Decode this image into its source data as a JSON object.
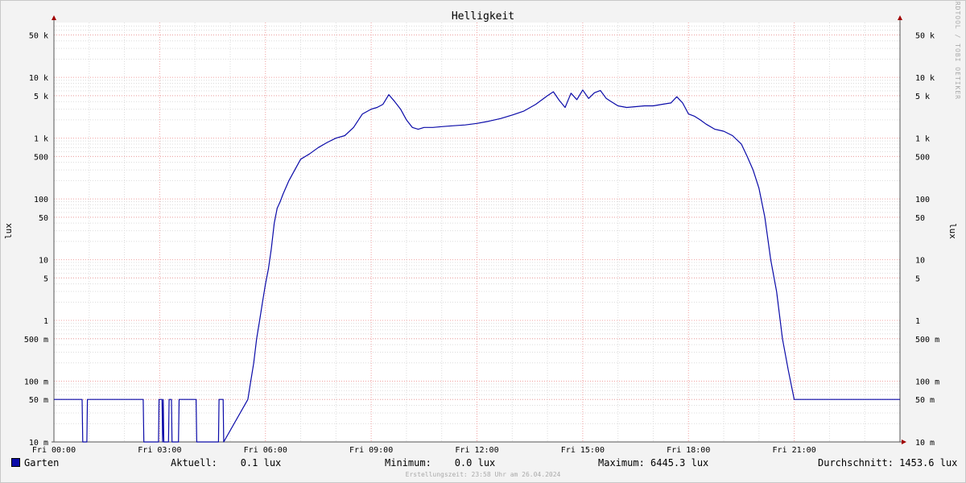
{
  "chart_data": {
    "type": "line",
    "title": "Helligkeit",
    "ylabel": "lux",
    "ylabel_right": "lux",
    "yscale": "log",
    "ylim": [
      0.01,
      80000
    ],
    "xlim": [
      "00:00",
      "24:00"
    ],
    "grid": true,
    "x_tick_labels": [
      "Fri 00:00",
      "Fri 03:00",
      "Fri 06:00",
      "Fri 09:00",
      "Fri 12:00",
      "Fri 15:00",
      "Fri 18:00",
      "Fri 21:00"
    ],
    "x_tick_hours": [
      0,
      3,
      6,
      9,
      12,
      15,
      18,
      21
    ],
    "y_ticks": [
      {
        "value": 0.01,
        "label": "10 m"
      },
      {
        "value": 0.05,
        "label": "50 m"
      },
      {
        "value": 0.1,
        "label": "100 m"
      },
      {
        "value": 0.5,
        "label": "500 m"
      },
      {
        "value": 1,
        "label": "1"
      },
      {
        "value": 5,
        "label": "5"
      },
      {
        "value": 10,
        "label": "10"
      },
      {
        "value": 50,
        "label": "50"
      },
      {
        "value": 100,
        "label": "100"
      },
      {
        "value": 500,
        "label": "500"
      },
      {
        "value": 1000,
        "label": "1 k"
      },
      {
        "value": 5000,
        "label": "5 k"
      },
      {
        "value": 10000,
        "label": "10 k"
      },
      {
        "value": 50000,
        "label": "50 k"
      }
    ],
    "series": [
      {
        "name": "Garten",
        "color": "#0a0aa8",
        "x": [
          "00:00",
          "00:48",
          "00:49",
          "00:56",
          "00:57",
          "02:32",
          "02:33",
          "02:58",
          "02:59",
          "03:04",
          "03:05",
          "03:06",
          "03:07",
          "03:15",
          "03:16",
          "03:20",
          "03:21",
          "03:32",
          "03:33",
          "04:02",
          "04:03",
          "04:40",
          "04:41",
          "04:48",
          "04:49",
          "05:30",
          "05:35",
          "05:40",
          "05:45",
          "05:50",
          "05:55",
          "06:00",
          "06:05",
          "06:10",
          "06:15",
          "06:20",
          "06:25",
          "06:30",
          "06:40",
          "06:50",
          "07:00",
          "07:15",
          "07:30",
          "07:45",
          "08:00",
          "08:15",
          "08:30",
          "08:45",
          "09:00",
          "09:10",
          "09:20",
          "09:30",
          "09:40",
          "09:50",
          "10:00",
          "10:10",
          "10:20",
          "10:30",
          "10:45",
          "11:00",
          "11:20",
          "11:40",
          "12:00",
          "12:20",
          "12:40",
          "13:00",
          "13:20",
          "13:40",
          "14:00",
          "14:10",
          "14:20",
          "14:30",
          "14:40",
          "14:50",
          "15:00",
          "15:10",
          "15:20",
          "15:30",
          "15:40",
          "15:50",
          "16:00",
          "16:15",
          "16:30",
          "16:45",
          "17:00",
          "17:15",
          "17:30",
          "17:40",
          "17:50",
          "18:00",
          "18:10",
          "18:20",
          "18:30",
          "18:45",
          "19:00",
          "19:15",
          "19:30",
          "19:40",
          "19:50",
          "20:00",
          "20:10",
          "20:20",
          "20:30",
          "20:40",
          "20:50",
          "21:00",
          "21:05",
          "21:10",
          "21:15",
          "21:20",
          "21:25",
          "21:30",
          "21:35",
          "21:40",
          "21:45",
          "24:00"
        ],
        "values": [
          0.05,
          0.05,
          0.01,
          0.01,
          0.05,
          0.05,
          0.01,
          0.01,
          0.05,
          0.05,
          0.01,
          0.05,
          0.01,
          0.01,
          0.05,
          0.05,
          0.01,
          0.01,
          0.05,
          0.05,
          0.01,
          0.01,
          0.05,
          0.05,
          0.01,
          0.05,
          0.1,
          0.2,
          0.5,
          1,
          2,
          4,
          7,
          15,
          40,
          70,
          90,
          120,
          200,
          300,
          450,
          550,
          700,
          850,
          1000,
          1100,
          1500,
          2500,
          3000,
          3200,
          3600,
          5200,
          4000,
          3000,
          2000,
          1500,
          1400,
          1500,
          1500,
          1550,
          1600,
          1650,
          1750,
          1900,
          2100,
          2400,
          2800,
          3600,
          5000,
          5800,
          4200,
          3200,
          5500,
          4300,
          6200,
          4500,
          5600,
          6100,
          4500,
          3900,
          3400,
          3200,
          3300,
          3400,
          3400,
          3600,
          3800,
          4800,
          3800,
          2500,
          2300,
          2000,
          1700,
          1400,
          1300,
          1100,
          800,
          500,
          300,
          150,
          50,
          10,
          3,
          0.5,
          0.15,
          0.05,
          0.05,
          0.05,
          0.05,
          0.05,
          0.05,
          0.05,
          0.05,
          0.05,
          0.05,
          0.05
        ]
      }
    ]
  },
  "legend": {
    "series_name": "Garten",
    "current": "Aktuell:    0.1 lux",
    "minimum": "Minimum:    0.0 lux",
    "maximum": "Maximum: 6445.3 lux",
    "average": "Durchschnitt: 1453.6 lux"
  },
  "watermark": "RRDTOOL / TOBI OETIKER",
  "footer": "Erstellungszeit: 23:58 Uhr am 26.04.2024"
}
